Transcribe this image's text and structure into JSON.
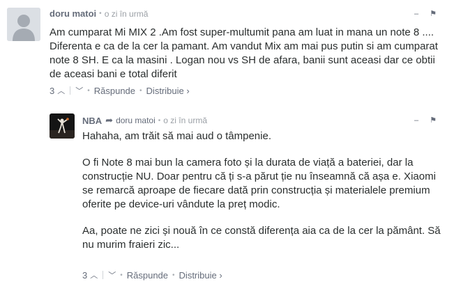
{
  "comments": [
    {
      "author": "doru matoi",
      "time": "o zi în urmă",
      "body": [
        "Am cumparat Mi MIX 2 .Am fost super-multumit pana am luat in mana un note 8 .... Diferenta e ca de la cer la pamant. Am vandut Mix am mai pus putin si am cumparat note 8 SH. E ca la masini . Logan nou vs SH de afara, banii sunt aceasi dar ce obtii de aceasi bani e total diferit"
      ],
      "votes": "3",
      "reply_label": "Răspunde",
      "share_label": "Distribuie ›"
    },
    {
      "author": "NBA",
      "reply_to": "doru matoi",
      "time": "o zi în urmă",
      "body": [
        "Hahaha, am trăit să mai aud o tâmpenie.",
        "O fi Note 8 mai bun la camera foto și la durata de viață a bateriei, dar la construcție NU. Doar pentru că ți s-a părut ție nu înseamnă că așa e. Xiaomi se remarcă aproape de fiecare dată prin construcția și materialele premium oferite pe device-uri vândute la preț modic.",
        "Aa, poate ne zici și nouă în ce constă diferența aia ca de la cer la pământ. Să nu murim fraieri zic..."
      ],
      "votes": "3",
      "reply_label": "Răspunde",
      "share_label": "Distribuie ›"
    }
  ],
  "icons": {
    "collapse": "–",
    "flag": "⚑",
    "vote_up": "︿",
    "vote_down": "﹀",
    "reply_arrow": "➦",
    "separator": "•"
  }
}
